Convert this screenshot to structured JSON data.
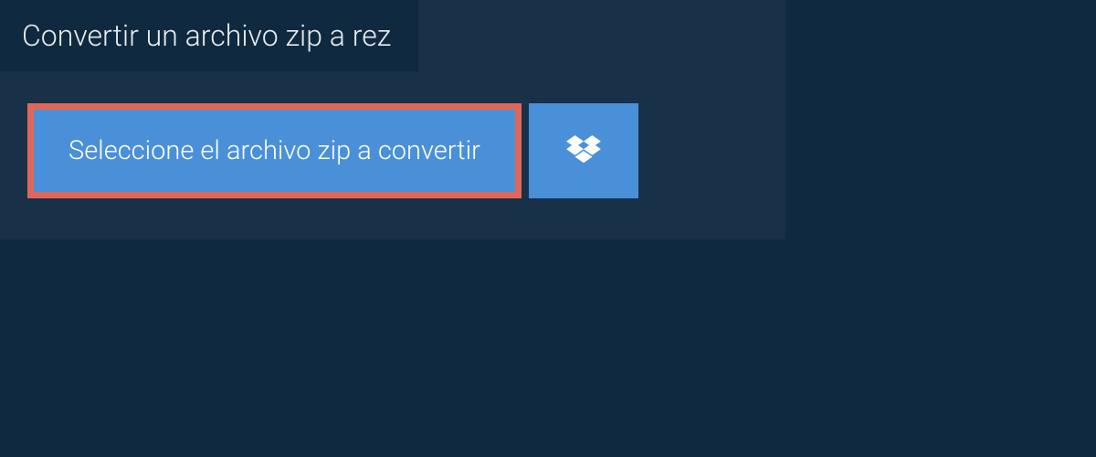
{
  "header": {
    "title": "Convertir un archivo zip a rez"
  },
  "actions": {
    "select_label": "Seleccione el archivo zip a convertir"
  },
  "colors": {
    "bg": "#0f2940",
    "panel": "#193049",
    "button": "#4a90d9",
    "highlight_border": "#e06757",
    "text_light": "#e8ecf0",
    "text_white": "#ffffff"
  }
}
